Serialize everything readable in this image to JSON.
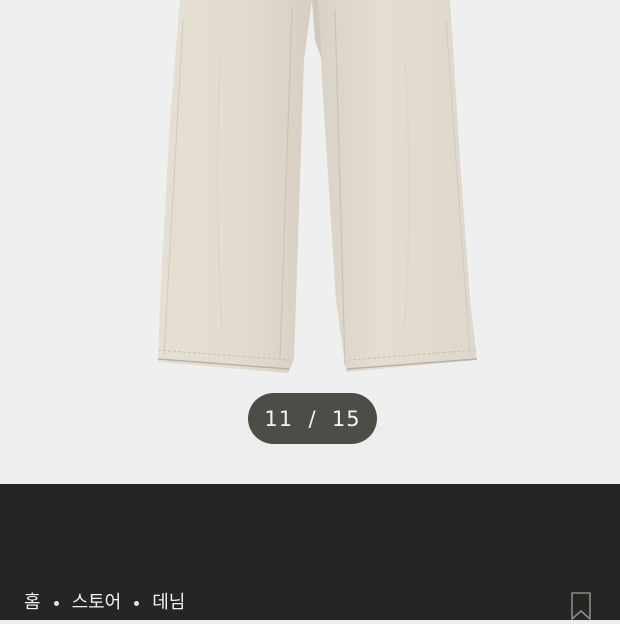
{
  "gallery": {
    "current_index": "11",
    "separator": "/",
    "total": "15"
  },
  "breadcrumb": {
    "items": [
      "홈",
      "스토어",
      "데님"
    ]
  },
  "icons": {
    "bookmark": "bookmark-icon"
  },
  "colors": {
    "gallery_bg": "#ededed",
    "counter_bg": "#4d4d47",
    "panel_bg": "#262523",
    "text_light": "#f2f2f2",
    "pants_fabric": "#e4ddd1"
  }
}
